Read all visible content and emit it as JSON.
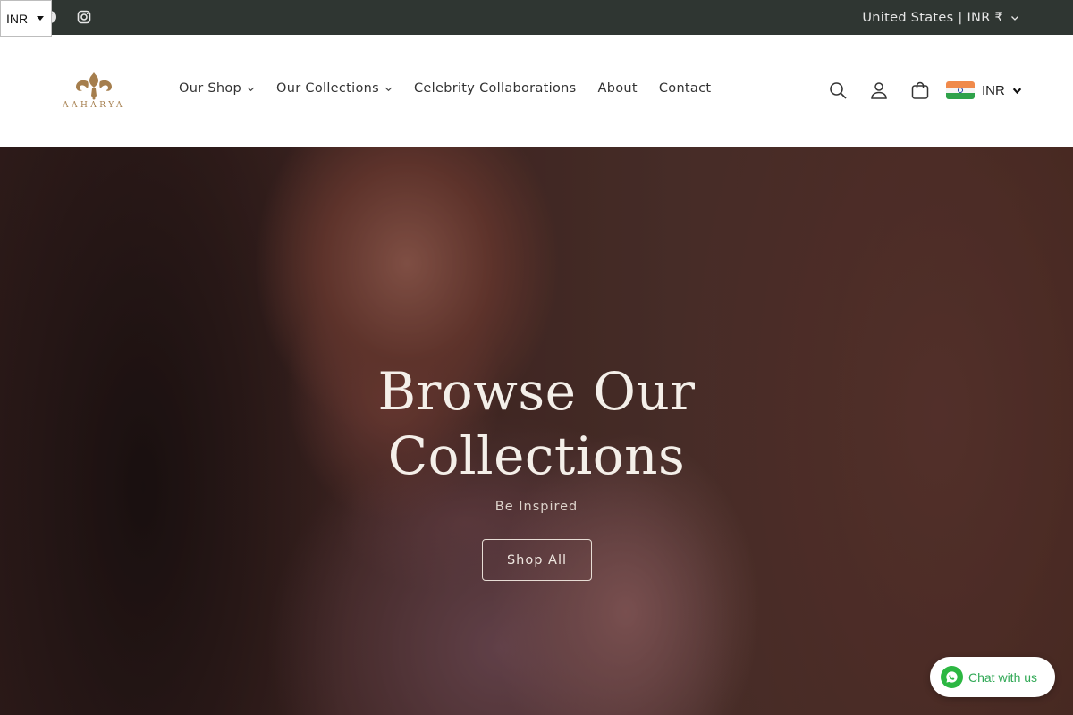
{
  "topbar": {
    "currency_select": "INR",
    "country_selector": "United States | INR ₹",
    "social_icons": [
      "facebook-icon",
      "instagram-icon"
    ]
  },
  "header": {
    "logo_text": "AAHARYA",
    "nav": [
      {
        "label": "Our Shop",
        "has_dropdown": true
      },
      {
        "label": "Our Collections",
        "has_dropdown": true
      },
      {
        "label": "Celebrity Collaborations",
        "has_dropdown": false
      },
      {
        "label": "About",
        "has_dropdown": false
      },
      {
        "label": "Contact",
        "has_dropdown": false
      }
    ],
    "icons": [
      "search-icon",
      "account-icon",
      "cart-icon"
    ],
    "currency": "INR"
  },
  "hero": {
    "title_line1": "Browse Our",
    "title_line2": "Collections",
    "subtitle": "Be Inspired",
    "button_label": "Shop All"
  },
  "chat": {
    "label": "Chat with us"
  },
  "colors": {
    "topbar_bg": "#2f3632",
    "brand_gold": "#a57e4d",
    "whatsapp_green": "#2cb742"
  }
}
